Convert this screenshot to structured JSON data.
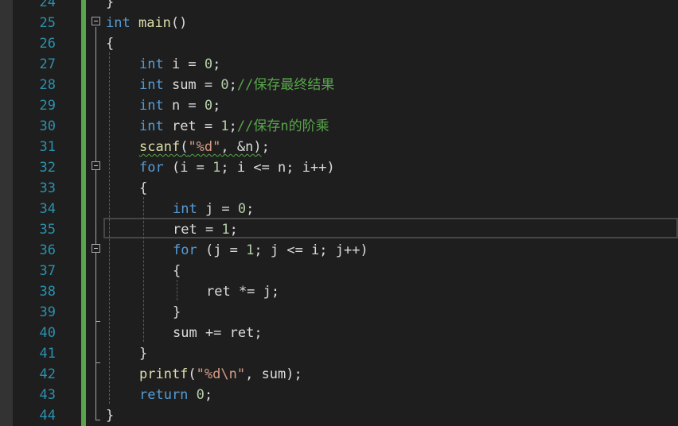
{
  "editor": {
    "language": "c",
    "current_line": 35,
    "colors": {
      "background": "#1e1e1e",
      "line_number": "#2b91af",
      "keyword": "#569cd6",
      "function": "#dcdcaa",
      "number": "#b5cea8",
      "string": "#d69d85",
      "comment": "#57a64a",
      "change_bar": "#57a64a"
    },
    "lines": [
      {
        "number": "24",
        "tokens": [
          {
            "t": "}",
            "c": "var"
          }
        ]
      },
      {
        "number": "25",
        "tokens": [
          {
            "t": "int",
            "c": "kw"
          },
          {
            "t": " ",
            "c": "var"
          },
          {
            "t": "main",
            "c": "fn"
          },
          {
            "t": "()",
            "c": "var"
          }
        ]
      },
      {
        "number": "26",
        "tokens": [
          {
            "t": "{",
            "c": "var"
          }
        ]
      },
      {
        "number": "27",
        "tokens": [
          {
            "t": "int",
            "c": "kw"
          },
          {
            "t": " i = ",
            "c": "var"
          },
          {
            "t": "0",
            "c": "num"
          },
          {
            "t": ";",
            "c": "var"
          }
        ]
      },
      {
        "number": "28",
        "tokens": [
          {
            "t": "int",
            "c": "kw"
          },
          {
            "t": " sum = ",
            "c": "var"
          },
          {
            "t": "0",
            "c": "num"
          },
          {
            "t": ";",
            "c": "var"
          },
          {
            "t": "//保存最终结果",
            "c": "cm"
          }
        ]
      },
      {
        "number": "29",
        "tokens": [
          {
            "t": "int",
            "c": "kw"
          },
          {
            "t": " n = ",
            "c": "var"
          },
          {
            "t": "0",
            "c": "num"
          },
          {
            "t": ";",
            "c": "var"
          }
        ]
      },
      {
        "number": "30",
        "tokens": [
          {
            "t": "int",
            "c": "kw"
          },
          {
            "t": " ret = ",
            "c": "var"
          },
          {
            "t": "1",
            "c": "num"
          },
          {
            "t": ";",
            "c": "var"
          },
          {
            "t": "//保存n的阶乘",
            "c": "cm"
          }
        ]
      },
      {
        "number": "31",
        "tokens": [
          {
            "t": "scanf",
            "c": "fn squiggle"
          },
          {
            "t": "(",
            "c": "var squiggle"
          },
          {
            "t": "\"%d\"",
            "c": "str squiggle"
          },
          {
            "t": ", &n)",
            "c": "var squiggle"
          },
          {
            "t": ";",
            "c": "var"
          }
        ]
      },
      {
        "number": "32",
        "tokens": [
          {
            "t": "for",
            "c": "kw"
          },
          {
            "t": " (i = ",
            "c": "var"
          },
          {
            "t": "1",
            "c": "num"
          },
          {
            "t": "; i <= n; i++)",
            "c": "var"
          }
        ]
      },
      {
        "number": "33",
        "tokens": [
          {
            "t": "{",
            "c": "var"
          }
        ]
      },
      {
        "number": "34",
        "tokens": [
          {
            "t": "int",
            "c": "kw"
          },
          {
            "t": " j = ",
            "c": "var"
          },
          {
            "t": "0",
            "c": "num"
          },
          {
            "t": ";",
            "c": "var"
          }
        ]
      },
      {
        "number": "35",
        "tokens": [
          {
            "t": "ret = ",
            "c": "var"
          },
          {
            "t": "1",
            "c": "num"
          },
          {
            "t": ";",
            "c": "var"
          }
        ]
      },
      {
        "number": "36",
        "tokens": [
          {
            "t": "for",
            "c": "kw"
          },
          {
            "t": " (j = ",
            "c": "var"
          },
          {
            "t": "1",
            "c": "num"
          },
          {
            "t": "; j <= i; j++)",
            "c": "var"
          }
        ]
      },
      {
        "number": "37",
        "tokens": [
          {
            "t": "{",
            "c": "var"
          }
        ]
      },
      {
        "number": "38",
        "tokens": [
          {
            "t": "ret *= j;",
            "c": "var"
          }
        ]
      },
      {
        "number": "39",
        "tokens": [
          {
            "t": "}",
            "c": "var"
          }
        ]
      },
      {
        "number": "40",
        "tokens": [
          {
            "t": "sum += ret;",
            "c": "var"
          }
        ]
      },
      {
        "number": "41",
        "tokens": [
          {
            "t": "}",
            "c": "var"
          }
        ]
      },
      {
        "number": "42",
        "tokens": [
          {
            "t": "printf",
            "c": "fn"
          },
          {
            "t": "(",
            "c": "var"
          },
          {
            "t": "\"%d\\n\"",
            "c": "str"
          },
          {
            "t": ", sum);",
            "c": "var"
          }
        ]
      },
      {
        "number": "43",
        "tokens": [
          {
            "t": "return",
            "c": "kw"
          },
          {
            "t": " ",
            "c": "var"
          },
          {
            "t": "0",
            "c": "num"
          },
          {
            "t": ";",
            "c": "var"
          }
        ]
      },
      {
        "number": "44",
        "tokens": [
          {
            "t": "}",
            "c": "var"
          }
        ]
      }
    ]
  }
}
